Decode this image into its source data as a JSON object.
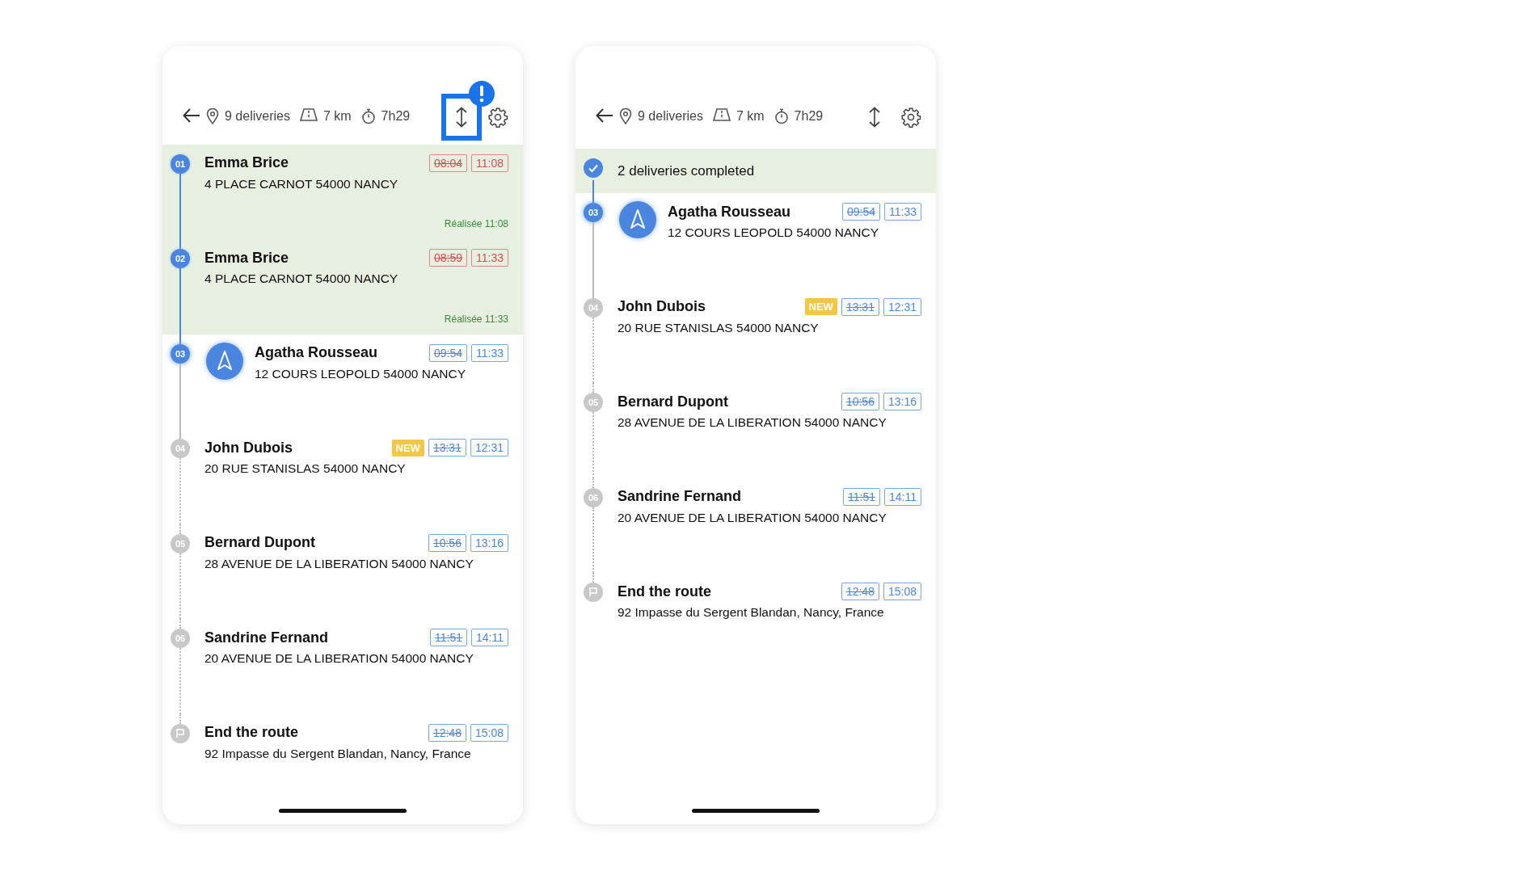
{
  "phones": [
    {
      "header": {
        "deliveries": "9 deliveries",
        "distance": "7 km",
        "duration": "7h29",
        "sort_alert": true
      },
      "stops": [
        {
          "number": "01",
          "kind": "delivery",
          "completed": true,
          "current": false,
          "name": "Emma Brice",
          "address": "4 PLACE CARNOT 54000 NANCY",
          "new": false,
          "planned": "08:04",
          "eta": "11:08",
          "done_text": "Réalisée 11:08"
        },
        {
          "number": "02",
          "kind": "delivery",
          "completed": true,
          "current": false,
          "name": "Emma Brice",
          "address": "4 PLACE CARNOT 54000 NANCY",
          "new": false,
          "planned": "08:59",
          "eta": "11:33",
          "done_text": "Réalisée 11:33"
        },
        {
          "number": "03",
          "kind": "delivery",
          "completed": false,
          "current": true,
          "name": "Agatha Rousseau",
          "address": "12 COURS LEOPOLD 54000 NANCY",
          "new": false,
          "planned": "09:54",
          "eta": "11:33"
        },
        {
          "number": "04",
          "kind": "delivery",
          "completed": false,
          "current": false,
          "name": "John Dubois",
          "address": "20 RUE STANISLAS 54000 NANCY",
          "new": true,
          "new_label": "NEW",
          "planned": "13:31",
          "eta": "12:31"
        },
        {
          "number": "05",
          "kind": "delivery",
          "completed": false,
          "current": false,
          "name": "Bernard Dupont",
          "address": "28 AVENUE DE LA LIBERATION 54000 NANCY",
          "new": false,
          "planned": "10:56",
          "eta": "13:16"
        },
        {
          "number": "06",
          "kind": "delivery",
          "completed": false,
          "current": false,
          "name": "Sandrine Fernand",
          "address": "20 AVENUE DE LA LIBERATION 54000 NANCY",
          "new": false,
          "planned": "11:51",
          "eta": "14:11"
        },
        {
          "kind": "end",
          "completed": false,
          "current": false,
          "name": "End the route",
          "address": "92 Impasse du Sergent Blandan, Nancy, France",
          "new": false,
          "planned": "12:48",
          "eta": "15:08"
        }
      ]
    },
    {
      "header": {
        "deliveries": "9 deliveries",
        "distance": "7 km",
        "duration": "7h29",
        "sort_alert": false
      },
      "completed_summary": "2 deliveries completed",
      "stops": [
        {
          "number": "03",
          "kind": "delivery",
          "completed": false,
          "current": true,
          "name": "Agatha Rousseau",
          "address": "12 COURS LEOPOLD 54000 NANCY",
          "new": false,
          "planned": "09:54",
          "eta": "11:33"
        },
        {
          "number": "04",
          "kind": "delivery",
          "completed": false,
          "current": false,
          "name": "John Dubois",
          "address": "20 RUE STANISLAS 54000 NANCY",
          "new": true,
          "new_label": "NEW",
          "planned": "13:31",
          "eta": "12:31"
        },
        {
          "number": "05",
          "kind": "delivery",
          "completed": false,
          "current": false,
          "name": "Bernard Dupont",
          "address": "28 AVENUE DE LA LIBERATION 54000 NANCY",
          "new": false,
          "planned": "10:56",
          "eta": "13:16"
        },
        {
          "number": "06",
          "kind": "delivery",
          "completed": false,
          "current": false,
          "name": "Sandrine Fernand",
          "address": "20 AVENUE DE LA LIBERATION 54000 NANCY",
          "new": false,
          "planned": "11:51",
          "eta": "14:11"
        },
        {
          "kind": "end",
          "completed": false,
          "current": false,
          "name": "End the route",
          "address": "92 Impasse du Sergent Blandan, Nancy, France",
          "new": false,
          "planned": "12:48",
          "eta": "15:08"
        }
      ]
    }
  ]
}
